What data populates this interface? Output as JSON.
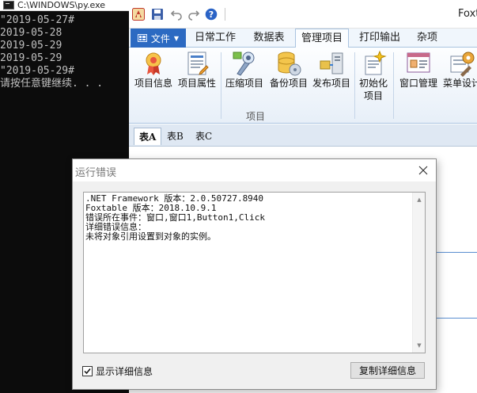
{
  "console": {
    "title": "C:\\WINDOWS\\py.exe",
    "lines": [
      "\"2019-05-27#",
      "2019-05-28",
      "2019-05-29",
      "2019-05-29",
      "\"2019-05-29#",
      "请按任意键继续. . ."
    ]
  },
  "app": {
    "title": "Foxt",
    "quick_access": [
      "app-logo-icon",
      "save-icon",
      "undo-icon",
      "redo-icon",
      "help-icon"
    ],
    "file_menu": "文件",
    "tabs": [
      {
        "label": "日常工作",
        "active": false
      },
      {
        "label": "数据表",
        "active": false
      },
      {
        "label": "管理项目",
        "active": true
      },
      {
        "label": "打印输出",
        "active": false
      },
      {
        "label": "杂项",
        "active": false
      }
    ],
    "ribbon": {
      "group_label": "项目",
      "buttons": [
        {
          "label": "项目信息",
          "icon": "project-info-icon"
        },
        {
          "label": "项目属性",
          "icon": "project-properties-icon"
        },
        {
          "label": "压缩项目",
          "icon": "compress-project-icon"
        },
        {
          "label": "备份项目",
          "icon": "backup-project-icon"
        },
        {
          "label": "发布项目",
          "icon": "publish-project-icon"
        },
        {
          "label": "初始化项目",
          "icon": "initialize-project-icon"
        },
        {
          "label": "窗口管理",
          "icon": "window-manager-icon"
        },
        {
          "label": "菜单设计",
          "icon": "menu-design-icon"
        }
      ]
    },
    "sheet_tabs": [
      {
        "label": "表A",
        "active": true
      },
      {
        "label": "表B",
        "active": false
      },
      {
        "label": "表C",
        "active": false
      }
    ]
  },
  "dialog": {
    "title": "运行错误",
    "lines": [
      ".NET Framework 版本：2.0.50727.8940",
      "Foxtable 版本：2018.10.9.1",
      "错误所在事件：窗口,窗口1,Button1,Click",
      "详细错误信息：",
      "未将对象引用设置到对象的实例。"
    ],
    "checkbox": {
      "label": "显示详细信息",
      "checked": true
    },
    "copy_button": "复制详细信息"
  },
  "colors": {
    "console_bg": "#0c0c0c",
    "console_text": "#c0c0c0",
    "file_button": "#2c6ac2",
    "ribbon_border": "#a9c3e0",
    "dialog_bg": "#f0f0f0"
  }
}
